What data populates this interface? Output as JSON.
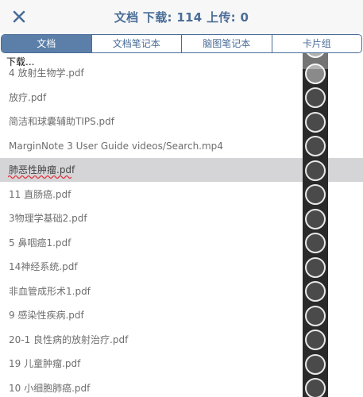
{
  "header": {
    "title": "文档 下载: 114 上传: 0",
    "close_icon": "close-icon"
  },
  "tabs": [
    {
      "label": "文档",
      "active": true
    },
    {
      "label": "文档笔记本",
      "active": false
    },
    {
      "label": "脑图笔记本",
      "active": false
    },
    {
      "label": "卡片组",
      "active": false
    }
  ],
  "list": {
    "loading_text": "下载...",
    "items": [
      {
        "name": "4 放射生物学.pdf"
      },
      {
        "name": "放疗.pdf"
      },
      {
        "name": "简洁和球囊辅助TIPS.pdf"
      },
      {
        "name": "MarginNote 3 User Guide videos/Search.mp4"
      },
      {
        "name": "肺恶性肿瘤.pdf",
        "selected": true
      },
      {
        "name": "11 直肠癌.pdf"
      },
      {
        "name": "3物理学基础2.pdf"
      },
      {
        "name": "5 鼻咽癌1.pdf"
      },
      {
        "name": "14神经系统.pdf"
      },
      {
        "name": "非血管成形术1.pdf"
      },
      {
        "name": "9 感染性疾病.pdf"
      },
      {
        "name": "20-1 良性病的放射治疗.pdf"
      },
      {
        "name": "19 儿童肿瘤.pdf"
      },
      {
        "name": "10 小细胞肺癌.pdf"
      }
    ]
  },
  "colors": {
    "accent": "#4a6d98",
    "active_tab_bg": "#5b7fa8",
    "selected_row_bg": "#d5d5d8",
    "spellcheck_underline": "#e0303a"
  }
}
